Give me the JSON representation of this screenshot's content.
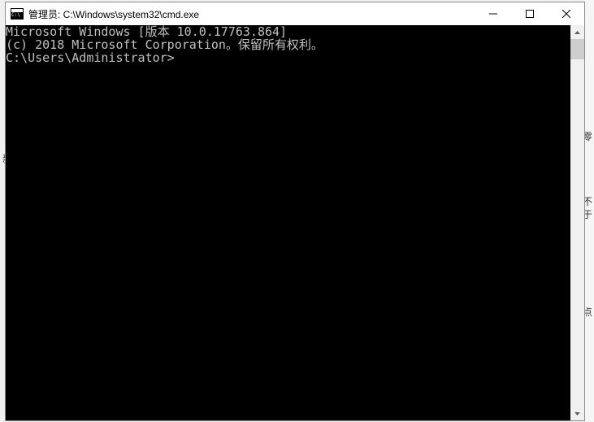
{
  "window": {
    "title": "管理员: C:\\Windows\\system32\\cmd.exe"
  },
  "terminal": {
    "line1": "Microsoft Windows [版本 10.0.17763.864]",
    "line2": "(c) 2018 Microsoft Corporation。保留所有权利。",
    "blank": "",
    "prompt": "C:\\Users\\Administrator>"
  },
  "background": {
    "left_char": "新",
    "right_seg1": "零",
    "right_seg2": "不于",
    "right_seg3": "点"
  }
}
